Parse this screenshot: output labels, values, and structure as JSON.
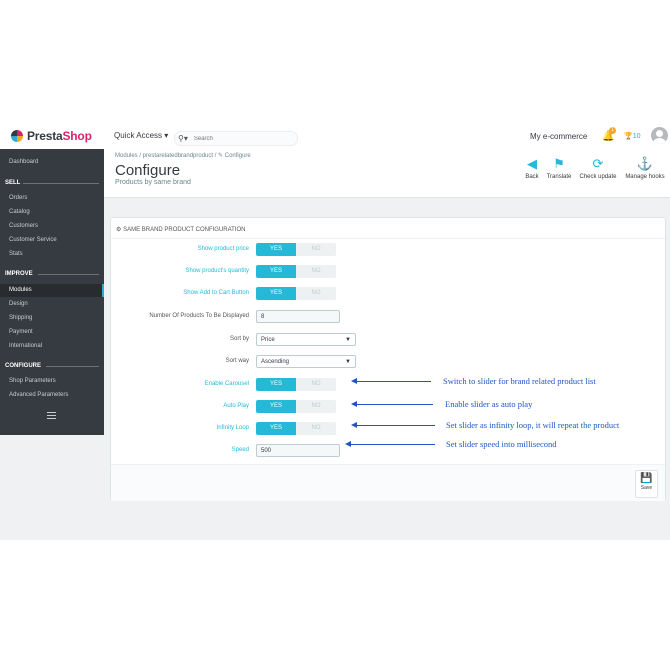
{
  "header": {
    "logo_prefix": "Presta",
    "logo_suffix": "Shop",
    "quick_access": "Quick Access ▾",
    "search_placeholder": "Search",
    "shop_name": "My e-commerce",
    "notification_count": "1",
    "trophy_count": "10"
  },
  "sidebar": {
    "dashboard": "Dashboard",
    "sell_title": "SELL",
    "sell_items": [
      "Orders",
      "Catalog",
      "Customers",
      "Customer Service",
      "Stats"
    ],
    "improve_title": "IMPROVE",
    "improve_items": [
      "Modules",
      "Design",
      "Shipping",
      "Payment",
      "International"
    ],
    "configure_title": "CONFIGURE",
    "configure_items": [
      "Shop Parameters",
      "Advanced Parameters"
    ]
  },
  "page": {
    "breadcrumb": "Modules  /  prestarelatedbrandproduct  /  ✎ Configure",
    "title": "Configure",
    "subtitle": "Products by same brand",
    "toolbar": [
      "Back",
      "Translate",
      "Check update",
      "Manage hooks"
    ]
  },
  "panel": {
    "heading": "SAME BRAND PRODUCT CONFIGURATION",
    "yes_label": "YES",
    "no_label": "NO",
    "fields": {
      "show_price": "Show product price",
      "show_qty": "Show product's quantity",
      "show_cart": "Show Add to Cart Button",
      "num_products": "Number Of Products To Be Displayed",
      "num_products_value": "8",
      "sort_by": "Sort by",
      "sort_by_value": "Price",
      "sort_way": "Sort way",
      "sort_way_value": "Ascending",
      "carousel": "Enable Carousel",
      "autoplay": "Auto Play",
      "infinity": "Infinity Loop",
      "speed": "Speed",
      "speed_value": "500"
    },
    "save_label": "Save"
  },
  "annotations": {
    "carousel_note": "Switch to slider for brand related product list",
    "autoplay_note": "Enable slider as auto play",
    "infinity_note": "Set slider as infinity loop, it will repeat the product",
    "speed_note": "Set slider speed into millisecond"
  },
  "colors": {
    "accent": "#25b9d7",
    "sidebar_bg": "#363a41",
    "brand_pink": "#d6246c",
    "annotation_blue": "#1f56c4"
  }
}
